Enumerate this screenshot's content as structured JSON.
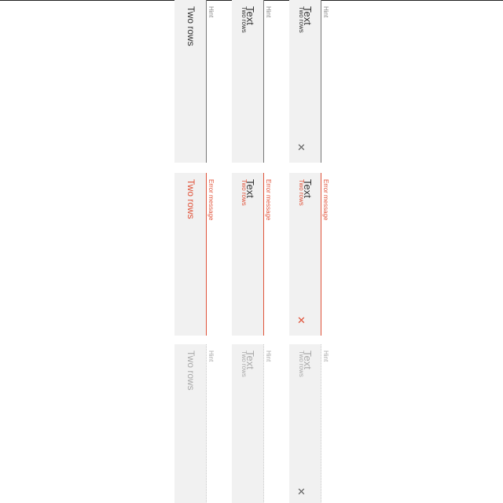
{
  "columns": [
    {
      "state": "normal",
      "fields": [
        {
          "value": "Two rows",
          "hint": "Hint"
        },
        {
          "label": "Two rows",
          "value": "Text",
          "hint": "Hint"
        },
        {
          "label": "Two rows",
          "value": "Text",
          "hint": "Hint",
          "clear_icon": "close-icon"
        }
      ]
    },
    {
      "state": "error",
      "fields": [
        {
          "value": "Two rows",
          "hint": "Error message"
        },
        {
          "label": "Two rows",
          "value": "Text",
          "hint": "Error message"
        },
        {
          "label": "Two rows",
          "value": "Text",
          "hint": "Error message",
          "clear_icon": "close-icon"
        }
      ]
    },
    {
      "state": "disabled",
      "fields": [
        {
          "value": "Two rows",
          "hint": "Hint"
        },
        {
          "label": "Two rows",
          "value": "Text",
          "hint": "Hint"
        },
        {
          "label": "Two rows",
          "value": "Text",
          "hint": "Hint",
          "clear_icon": "close-icon"
        }
      ]
    }
  ],
  "colors": {
    "normal_text": "#333333",
    "normal_hint": "#888888",
    "normal_border": "#777777",
    "error": "#e0533a",
    "disabled_text": "#aaaaaa",
    "disabled_border": "#cccccc",
    "field_bg": "#f1f1f1",
    "clear_icon": "#666666"
  },
  "clear_glyph": "✕"
}
